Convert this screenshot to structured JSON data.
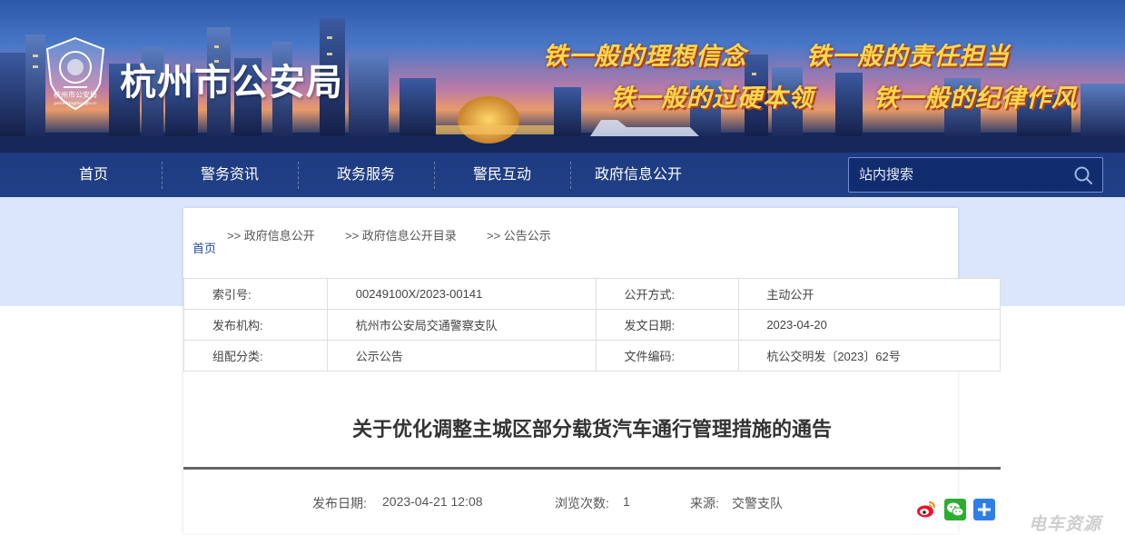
{
  "header": {
    "site_title": "杭州市公安局",
    "emblem_text": "杭州市公安局",
    "emblem_subtext": "police.hangzhou.gov.cn",
    "slogans": [
      "铁一般的理想信念",
      "铁一般的责任担当",
      "铁一般的过硬本领",
      "铁一般的纪律作风"
    ]
  },
  "nav": {
    "items": [
      "首页",
      "警务资讯",
      "政务服务",
      "警民互动",
      "政府信息公开"
    ],
    "search_placeholder": "站内搜索"
  },
  "breadcrumb": {
    "home": "首页",
    "items": [
      ">> 政府信息公开",
      ">> 政府信息公开目录",
      ">> 公告公示"
    ]
  },
  "info": {
    "rows": [
      [
        "索引号:",
        "00249100X/2023-00141",
        "公开方式:",
        "主动公开"
      ],
      [
        "发布机构:",
        "杭州市公安局交通警察支队",
        "发文日期:",
        "2023-04-20"
      ],
      [
        "组配分类:",
        "公示公告",
        "文件编码:",
        "杭公交明发〔2023〕62号"
      ]
    ]
  },
  "article": {
    "title": "关于优化调整主城区部分载货汽车通行管理措施的通告",
    "publish_label": "发布日期:",
    "publish_value": "2023-04-21 12:08",
    "views_label": "浏览次数:",
    "views_value": "1",
    "source_label": "来源:",
    "source_value": "交警支队"
  },
  "watermark": "电车资源",
  "colors": {
    "nav_bg": "#1d3c82",
    "band_bg": "#dbe6fb",
    "slogan": "#ffd84a",
    "link": "#1f4aa5"
  },
  "icons": [
    "police-emblem-icon",
    "search-icon",
    "weibo-share-icon",
    "wechat-share-icon",
    "more-share-icon"
  ]
}
